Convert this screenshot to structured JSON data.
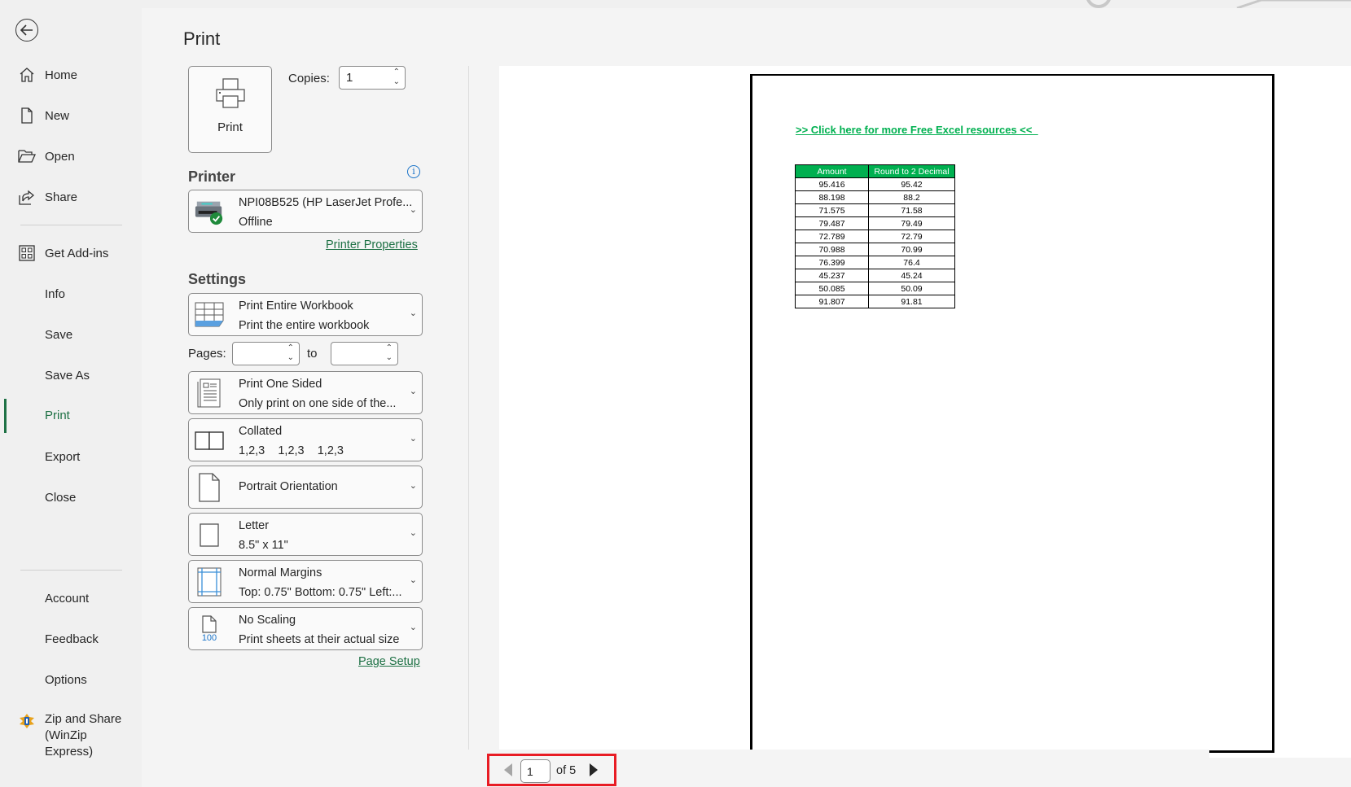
{
  "sidebar": {
    "back_label": "Back",
    "items": [
      {
        "label": "Home",
        "icon": "home-icon"
      },
      {
        "label": "New",
        "icon": "new-document-icon"
      },
      {
        "label": "Open",
        "icon": "folder-open-icon"
      },
      {
        "label": "Share",
        "icon": "share-icon"
      },
      {
        "label": "Get Add-ins",
        "icon": "add-ins-grid-icon"
      },
      {
        "label": "Info"
      },
      {
        "label": "Save"
      },
      {
        "label": "Save As"
      },
      {
        "label": "Print",
        "active": true
      },
      {
        "label": "Export"
      },
      {
        "label": "Close"
      },
      {
        "label": "Account"
      },
      {
        "label": "Feedback"
      },
      {
        "label": "Options"
      }
    ],
    "winzip": {
      "line1": "Zip and Share",
      "line2": "(WinZip",
      "line3": "Express)",
      "icon": "winzip-icon"
    }
  },
  "main": {
    "title": "Print",
    "print_button_label": "Print",
    "copies_label": "Copies:",
    "copies_value": "1",
    "printer_heading": "Printer",
    "printer": {
      "name": "NPI08B525 (HP LaserJet Profe...",
      "status": "Offline"
    },
    "printer_properties_link": "Printer Properties",
    "settings_heading": "Settings",
    "pages_label": "Pages:",
    "to_label": "to",
    "pages_from": "",
    "pages_to": "",
    "settings": [
      {
        "line1": "Print Entire Workbook",
        "line2": "Print the entire workbook",
        "icon": "workbook-grid-icon"
      },
      {
        "line1": "Print One Sided",
        "line2": "Only print on one side of the...",
        "icon": "one-sided-page-icon"
      },
      {
        "line1": "Collated",
        "line2": "1,2,3    1,2,3    1,2,3",
        "icon": "collated-icon"
      },
      {
        "line1": "Portrait Orientation",
        "line2": "",
        "icon": "portrait-page-icon"
      },
      {
        "line1": "Letter",
        "line2": "8.5\" x 11\"",
        "icon": "paper-size-icon"
      },
      {
        "line1": "Normal Margins",
        "line2": "Top: 0.75\" Bottom: 0.75\" Left:...",
        "icon": "margins-icon"
      },
      {
        "line1": "No Scaling",
        "line2": "Print sheets at their actual size",
        "icon": "scaling-100-icon",
        "icon_text": "100"
      }
    ],
    "page_setup_link": "Page Setup"
  },
  "preview": {
    "link_text": ">> Click here for more Free Excel resources <<  ",
    "table": {
      "headers": [
        "Amount",
        "Round to 2 Decimal"
      ],
      "rows": [
        [
          "95.416",
          "95.42"
        ],
        [
          "88.198",
          "88.2"
        ],
        [
          "71.575",
          "71.58"
        ],
        [
          "79.487",
          "79.49"
        ],
        [
          "72.789",
          "72.79"
        ],
        [
          "70.988",
          "70.99"
        ],
        [
          "76.399",
          "76.4"
        ],
        [
          "45.237",
          "45.24"
        ],
        [
          "50.085",
          "50.09"
        ],
        [
          "91.807",
          "91.81"
        ]
      ]
    },
    "colors": {
      "header_bg": "#00b050",
      "link": "#00b050",
      "accent": "#1e7145",
      "highlight": "#e81c24"
    }
  },
  "page_nav": {
    "current_page": "1",
    "of_label": "of 5"
  }
}
